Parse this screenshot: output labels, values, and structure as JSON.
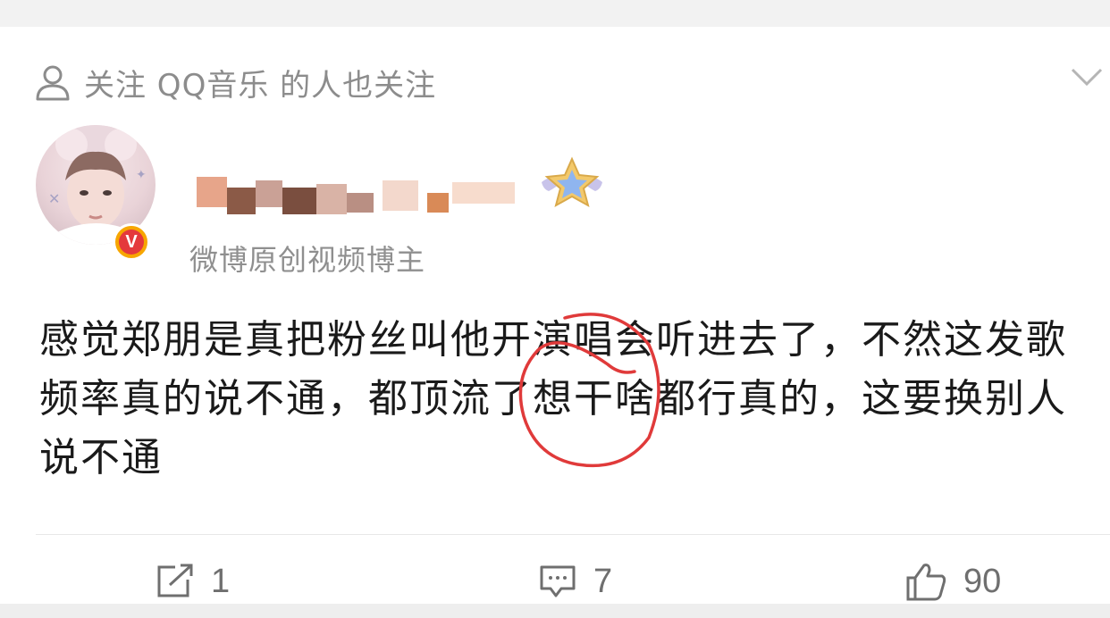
{
  "recommendation": {
    "text": "关注 QQ音乐 的人也关注"
  },
  "user": {
    "name": "",
    "title": "微博原创视频博主",
    "verified_badge": "V"
  },
  "post": {
    "text": "感觉郑朋是真把粉丝叫他开演唱会听进去了，不然这发歌频率真的说不通，都顶流了想干啥都行真的，这要换别人说不通"
  },
  "actions": {
    "repost_count": "1",
    "comment_count": "7",
    "like_count": "90"
  },
  "icons": {
    "follow": "person-outline-icon",
    "collapse": "chevron-down-icon",
    "member": "winged-star-badge-icon",
    "repost": "share-box-icon",
    "comment": "comment-bubble-icon",
    "like": "thumbs-up-icon"
  },
  "colors": {
    "text": "#1a1a1a",
    "muted": "#8c8c8c",
    "verified": "#f7a600",
    "annotation_circle": "#e03a3a"
  }
}
